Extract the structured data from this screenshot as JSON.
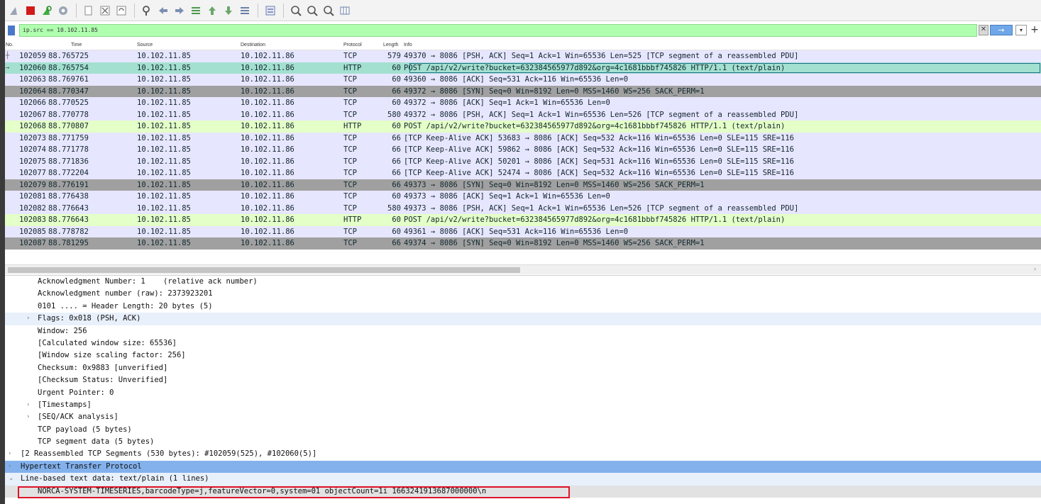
{
  "toolbar": {
    "icons": [
      "shark-fin-start-icon",
      "stop-capture-icon",
      "restart-capture-icon",
      "capture-options-icon",
      "open-file-icon",
      "save-file-icon",
      "close-file-icon",
      "reload-file-icon",
      "find-packet-icon",
      "go-back-icon",
      "go-forward-icon",
      "go-to-packet-icon",
      "go-first-icon",
      "go-last-icon",
      "autoscroll-icon",
      "colorize-icon",
      "zoom-in-icon",
      "zoom-out-icon",
      "zoom-normal-icon",
      "resize-columns-icon"
    ]
  },
  "filter": {
    "value": "ip.src == 10.102.11.85",
    "clear_glyph": "✕",
    "apply_glyph": "→",
    "dropdown_glyph": "▾",
    "add_glyph": "+"
  },
  "packet_list": {
    "headers": {
      "no": "No.",
      "time": "Time",
      "source": "Source",
      "destination": "Destination",
      "protocol": "Protocol",
      "length": "Length",
      "info": "Info"
    },
    "rows": [
      {
        "no": "102059",
        "time": "88.765725",
        "src": "10.102.11.85",
        "dst": "10.102.11.86",
        "proto": "TCP",
        "len": "579",
        "info": "49370 → 8086 [PSH, ACK] Seq=1 Ack=1 Win=65536 Len=525 [TCP segment of a reassembled PDU]",
        "kind": "tcp",
        "arrow": "┼"
      },
      {
        "no": "102060",
        "time": "88.765754",
        "src": "10.102.11.85",
        "dst": "10.102.11.86",
        "proto": "HTTP",
        "len": "60",
        "info": "POST /api/v2/write?bucket=632384565977d892&org=4c1681bbbf745826 HTTP/1.1  (text/plain)",
        "kind": "sel",
        "arrow": "→"
      },
      {
        "no": "102063",
        "time": "88.769761",
        "src": "10.102.11.85",
        "dst": "10.102.11.86",
        "proto": "TCP",
        "len": "60",
        "info": "49360 → 8086 [ACK] Seq=531 Ack=116 Win=65536 Len=0",
        "kind": "tcp",
        "arrow": ""
      },
      {
        "no": "102064",
        "time": "88.770347",
        "src": "10.102.11.85",
        "dst": "10.102.11.86",
        "proto": "TCP",
        "len": "66",
        "info": "49372 → 8086 [SYN] Seq=0 Win=8192 Len=0 MSS=1460 WS=256 SACK_PERM=1",
        "kind": "syn",
        "arrow": ""
      },
      {
        "no": "102066",
        "time": "88.770525",
        "src": "10.102.11.85",
        "dst": "10.102.11.86",
        "proto": "TCP",
        "len": "60",
        "info": "49372 → 8086 [ACK] Seq=1 Ack=1 Win=65536 Len=0",
        "kind": "tcp",
        "arrow": ""
      },
      {
        "no": "102067",
        "time": "88.770778",
        "src": "10.102.11.85",
        "dst": "10.102.11.86",
        "proto": "TCP",
        "len": "580",
        "info": "49372 → 8086 [PSH, ACK] Seq=1 Ack=1 Win=65536 Len=526 [TCP segment of a reassembled PDU]",
        "kind": "tcp",
        "arrow": ""
      },
      {
        "no": "102068",
        "time": "88.770807",
        "src": "10.102.11.85",
        "dst": "10.102.11.86",
        "proto": "HTTP",
        "len": "60",
        "info": "POST /api/v2/write?bucket=632384565977d892&org=4c1681bbbf745826 HTTP/1.1  (text/plain)",
        "kind": "http",
        "arrow": ""
      },
      {
        "no": "102073",
        "time": "88.771759",
        "src": "10.102.11.85",
        "dst": "10.102.11.86",
        "proto": "TCP",
        "len": "66",
        "info": "[TCP Keep-Alive ACK] 53683 → 8086 [ACK] Seq=532 Ack=116 Win=65536 Len=0 SLE=115 SRE=116",
        "kind": "tcp",
        "arrow": ""
      },
      {
        "no": "102074",
        "time": "88.771778",
        "src": "10.102.11.85",
        "dst": "10.102.11.86",
        "proto": "TCP",
        "len": "66",
        "info": "[TCP Keep-Alive ACK] 59862 → 8086 [ACK] Seq=532 Ack=116 Win=65536 Len=0 SLE=115 SRE=116",
        "kind": "tcp",
        "arrow": ""
      },
      {
        "no": "102075",
        "time": "88.771836",
        "src": "10.102.11.85",
        "dst": "10.102.11.86",
        "proto": "TCP",
        "len": "66",
        "info": "[TCP Keep-Alive ACK] 50201 → 8086 [ACK] Seq=531 Ack=116 Win=65536 Len=0 SLE=115 SRE=116",
        "kind": "tcp",
        "arrow": ""
      },
      {
        "no": "102077",
        "time": "88.772204",
        "src": "10.102.11.85",
        "dst": "10.102.11.86",
        "proto": "TCP",
        "len": "66",
        "info": "[TCP Keep-Alive ACK] 52474 → 8086 [ACK] Seq=532 Ack=116 Win=65536 Len=0 SLE=115 SRE=116",
        "kind": "tcp",
        "arrow": ""
      },
      {
        "no": "102079",
        "time": "88.776191",
        "src": "10.102.11.85",
        "dst": "10.102.11.86",
        "proto": "TCP",
        "len": "66",
        "info": "49373 → 8086 [SYN] Seq=0 Win=8192 Len=0 MSS=1460 WS=256 SACK_PERM=1",
        "kind": "syn",
        "arrow": ""
      },
      {
        "no": "102081",
        "time": "88.776438",
        "src": "10.102.11.85",
        "dst": "10.102.11.86",
        "proto": "TCP",
        "len": "60",
        "info": "49373 → 8086 [ACK] Seq=1 Ack=1 Win=65536 Len=0",
        "kind": "tcp",
        "arrow": ""
      },
      {
        "no": "102082",
        "time": "88.776643",
        "src": "10.102.11.85",
        "dst": "10.102.11.86",
        "proto": "TCP",
        "len": "580",
        "info": "49373 → 8086 [PSH, ACK] Seq=1 Ack=1 Win=65536 Len=526 [TCP segment of a reassembled PDU]",
        "kind": "tcp",
        "arrow": ""
      },
      {
        "no": "102083",
        "time": "88.776643",
        "src": "10.102.11.85",
        "dst": "10.102.11.86",
        "proto": "HTTP",
        "len": "60",
        "info": "POST /api/v2/write?bucket=632384565977d892&org=4c1681bbbf745826 HTTP/1.1  (text/plain)",
        "kind": "http",
        "arrow": ""
      },
      {
        "no": "102085",
        "time": "88.778782",
        "src": "10.102.11.85",
        "dst": "10.102.11.86",
        "proto": "TCP",
        "len": "60",
        "info": "49361 → 8086 [ACK] Seq=531 Ack=116 Win=65536 Len=0",
        "kind": "tcp",
        "arrow": ""
      },
      {
        "no": "102087",
        "time": "88.781295",
        "src": "10.102.11.85",
        "dst": "10.102.11.86",
        "proto": "TCP",
        "len": "66",
        "info": "49374 → 8086 [SYN] Seq=0 Win=8192 Len=0 MSS=1460 WS=256 SACK_PERM=1",
        "kind": "syn",
        "arrow": ""
      }
    ]
  },
  "details": {
    "rows": [
      {
        "text": "Acknowledgment Number: 1    (relative ack number)",
        "level": "ind1",
        "exp": "",
        "bg": ""
      },
      {
        "text": "Acknowledgment number (raw): 2373923201",
        "level": "ind1",
        "exp": "",
        "bg": ""
      },
      {
        "text": "0101 .... = Header Length: 20 bytes (5)",
        "level": "ind1",
        "exp": "",
        "bg": ""
      },
      {
        "text": "Flags: 0x018 (PSH, ACK)",
        "level": "ind1",
        "exp": "›",
        "bg": "light"
      },
      {
        "text": "Window: 256",
        "level": "ind1",
        "exp": "",
        "bg": ""
      },
      {
        "text": "[Calculated window size: 65536]",
        "level": "ind1",
        "exp": "",
        "bg": ""
      },
      {
        "text": "[Window size scaling factor: 256]",
        "level": "ind1",
        "exp": "",
        "bg": ""
      },
      {
        "text": "Checksum: 0x9883 [unverified]",
        "level": "ind1",
        "exp": "",
        "bg": ""
      },
      {
        "text": "[Checksum Status: Unverified]",
        "level": "ind1",
        "exp": "",
        "bg": ""
      },
      {
        "text": "Urgent Pointer: 0",
        "level": "ind1",
        "exp": "",
        "bg": ""
      },
      {
        "text": "[Timestamps]",
        "level": "ind1",
        "exp": "›",
        "bg": ""
      },
      {
        "text": "[SEQ/ACK analysis]",
        "level": "ind1",
        "exp": "›",
        "bg": ""
      },
      {
        "text": "TCP payload (5 bytes)",
        "level": "ind1",
        "exp": "",
        "bg": ""
      },
      {
        "text": "TCP segment data (5 bytes)",
        "level": "ind1",
        "exp": "",
        "bg": ""
      },
      {
        "text": "[2 Reassembled TCP Segments (530 bytes): #102059(525), #102060(5)]",
        "level": "ind0",
        "exp": "›",
        "bg": ""
      },
      {
        "text": "Hypertext Transfer Protocol",
        "level": "ind0",
        "exp": "›",
        "bg": "blue"
      },
      {
        "text": "Line-based text data: text/plain (1 lines)",
        "level": "ind0",
        "exp": "⌄",
        "bg": "light"
      },
      {
        "text": "NORCA-SYSTEM-TIMESERIES,barcodeType=j,featureVector=0,system=01 objectCount=1i 1663241913687000000\\n",
        "level": "ind2",
        "exp": "",
        "bg": "gray",
        "boxed": true
      }
    ]
  },
  "colors": {
    "tcp_row": "#e7e6ff",
    "http_row": "#e4ffc7",
    "syn_row": "#a0a0a0",
    "selected_row": "#a3e0d0",
    "filter_bg": "#afffaf",
    "highlight_border": "#e0142a"
  }
}
